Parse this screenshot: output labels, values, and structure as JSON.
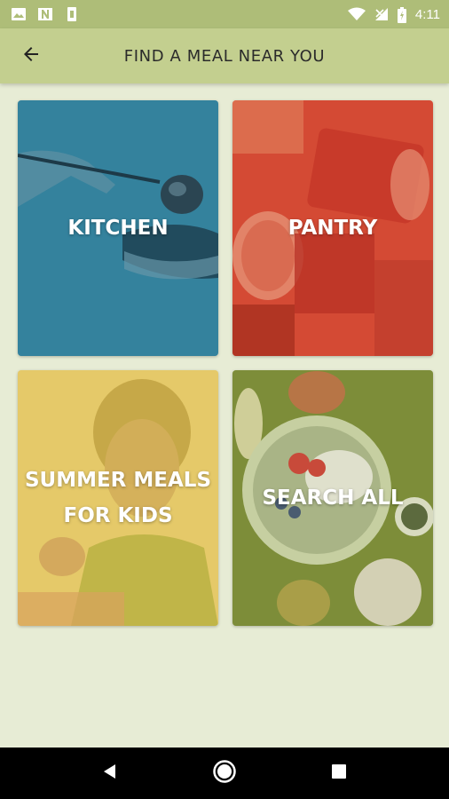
{
  "status_bar": {
    "time": "4:11",
    "icons": [
      "image-icon",
      "n-icon",
      "sim-icon",
      "wifi-icon",
      "signal-icon",
      "battery-icon"
    ]
  },
  "app_bar": {
    "title": "FIND A MEAL NEAR YOU",
    "back_icon": "arrow-back-icon"
  },
  "tiles": [
    {
      "label": "KITCHEN",
      "color": "#2f7a96"
    },
    {
      "label": "PANTRY",
      "color": "#d44a34"
    },
    {
      "label": "SUMMER MEALS\nFOR KIDS",
      "color": "#e3c35a"
    },
    {
      "label": "SEARCH ALL",
      "color": "#8a9a3e"
    }
  ],
  "nav_bar": {
    "buttons": [
      "back-triangle-icon",
      "home-circle-icon",
      "recents-square-icon"
    ]
  },
  "colors": {
    "status_bar": "#aebd78",
    "app_bar": "#c3cf8f",
    "background": "#e7ecd5"
  }
}
